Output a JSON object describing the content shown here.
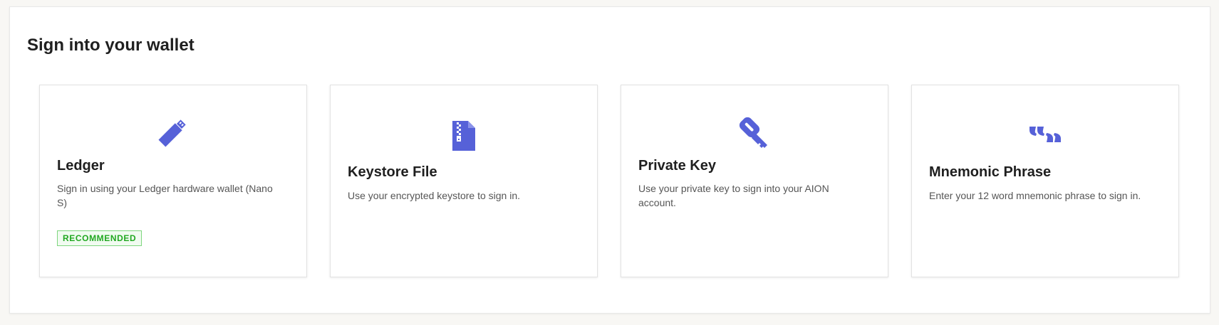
{
  "page": {
    "title": "Sign into your wallet"
  },
  "theme": {
    "accent": "#5661d8",
    "badge_green": "#21a821",
    "background": "#f8f7f4"
  },
  "cards": [
    {
      "icon": "usb-stick-icon",
      "title": "Ledger",
      "description": "Sign in using your Ledger hardware wallet (Nano S)",
      "badge": "RECOMMENDED"
    },
    {
      "icon": "zip-file-icon",
      "title": "Keystore File",
      "description": "Use your encrypted keystore to sign in."
    },
    {
      "icon": "key-icon",
      "title": "Private Key",
      "description": "Use your private key to sign into your AION account."
    },
    {
      "icon": "quote-icon",
      "title": "Mnemonic Phrase",
      "description": "Enter your 12 word mnemonic phrase to sign in."
    }
  ]
}
